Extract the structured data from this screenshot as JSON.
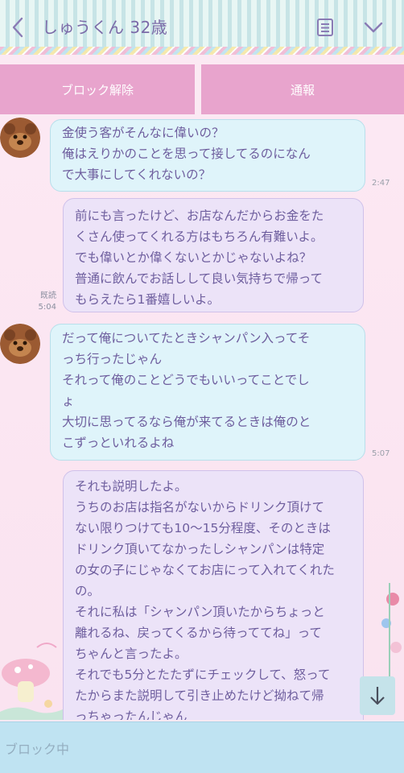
{
  "header": {
    "title": "しゅうくん 32歳",
    "back_icon": "chevron-left-icon",
    "memo_icon": "memo-icon",
    "menu_icon": "chevron-down-icon"
  },
  "actions": {
    "unblock_label": "ブロック解除",
    "report_label": "通報"
  },
  "messages": [
    {
      "side": "incoming",
      "lines": [
        "金使う客がそんなに偉いの？",
        "俺はえりかのことを思って接してるのになん",
        "で大事にしてくれないの？"
      ],
      "time": "2:47"
    },
    {
      "side": "outgoing",
      "lines": [
        "前にも言ったけど、お店なんだからお金をた",
        "くさん使ってくれる方はもちろん有難いよ。",
        "でも偉いとか偉くないとかじゃないよね？",
        "普通に飲んでお話しして良い気持ちで帰って",
        "もらえたら1番嬉しいよ。"
      ],
      "read": "既読",
      "time": "5:04"
    },
    {
      "side": "incoming",
      "lines": [
        "だって俺についてたときシャンパン入ってそ",
        "っち行ったじゃん",
        "それって俺のことどうでもいいってことでし",
        "ょ",
        "大切に思ってるなら俺が来てるときは俺のと",
        "こずっといれるよね"
      ],
      "time": "5:07"
    },
    {
      "side": "outgoing",
      "lines": [
        "それも説明したよ。",
        "うちのお店は指名がないからドリンク頂けて",
        "ない限りつけても10〜15分程度、そのときは",
        "ドリンク頂いてなかったしシャンパンは特定",
        "の女の子にじゃなくてお店にって入れてくれた",
        "の。",
        "それに私は「シャンパン頂いたからちょっと",
        "離れるね、戻ってくるから待っててね」って",
        "ちゃんと言ったよ。",
        "それでも5分とたたずにチェックして、怒って",
        "たからまた説明して引き止めたけど拗ねて帰",
        "っちゃったんじゃん"
      ]
    }
  ],
  "input": {
    "placeholder": "ブロック中"
  },
  "colors": {
    "action_button": "#e8a4cd",
    "incoming_bubble": "#dff4fa",
    "outgoing_bubble": "#ece3f8",
    "text": "#6e5e9e",
    "input_bar": "#bfe3f2"
  }
}
